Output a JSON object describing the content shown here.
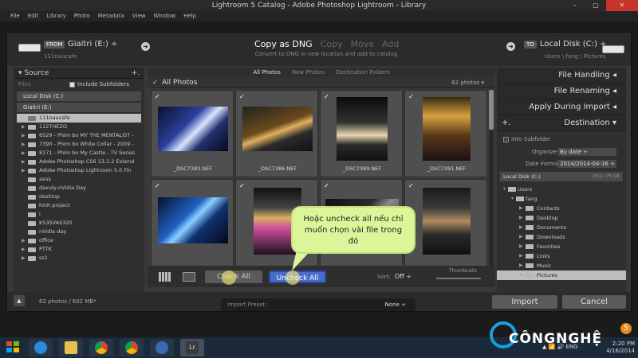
{
  "window": {
    "title": "Lightroom 5 Catalog - Adobe Photoshop Lightroom - Library",
    "min": "–",
    "max": "▢",
    "close": "✕"
  },
  "menu": [
    "File",
    "Edit",
    "Library",
    "Photo",
    "Metadata",
    "View",
    "Window",
    "Help"
  ],
  "header": {
    "from_tag": "FROM",
    "from_name": "Giaitri (E:) ÷",
    "from_path": "111naucafe",
    "modes": [
      "Copy as DNG",
      "Copy",
      "Move",
      "Add"
    ],
    "mode_desc": "Convert to DNG in new location and add to catalog",
    "to_tag": "TO",
    "to_name": "Local Disk (C:) ÷",
    "to_path": "Users \\ fang \\ Pictures"
  },
  "source": {
    "title": "Source",
    "plus": "+.",
    "files_label": "Files",
    "include_sub": "Include Subfolders",
    "drive1": "Local Disk (C:)",
    "drive2": "Giaitri (E:)",
    "folders": [
      "111naucafe",
      "112THEZO",
      "6529 - Phim bo MY THE MENTALIST -",
      "7390 - Phim bo White Collar - 2009 -",
      "8171 - Phim bo My Castle - TV Series",
      "Adobe Photoshop CS6 13.1.2 Extend",
      "Adobe Photoshop Lightroom 5.0 Fin",
      "asus",
      "daxuly-nVidia Day",
      "desktop",
      "hinh project",
      "i",
      "K53SVAS320",
      "nVidia day",
      "office",
      "PTTK",
      "ss1"
    ]
  },
  "center": {
    "tabs": [
      "All Photos",
      "New Photos",
      "Destination Folders"
    ],
    "all_label": "All Photos",
    "count": "62 photos ▾",
    "check_mark": "✓",
    "photos": [
      "_DSC7383.NEF",
      "_DSC7386.NEF",
      "_DSC7389.NEF",
      "_DSC7391.NEF",
      "",
      "",
      "",
      ""
    ]
  },
  "toolbar": {
    "check_all": "Check All",
    "uncheck_all": "Uncheck All",
    "sort_label": "Sort:",
    "sort_value": "Off ÷",
    "thumbs_label": "Thumbnails"
  },
  "right": {
    "sections": [
      "File Handling",
      "File Renaming",
      "Apply During Import"
    ],
    "dest_title": "Destination",
    "dest_plus": "+.",
    "into_sub": "Into Subfolder",
    "organize_l": "Organize",
    "organize_v": "By date ÷",
    "date_l": "Date Format",
    "date_v": "2014/2014-04-16 ÷",
    "drive": "Local Disk (C:)",
    "drive_size": "28.0 / 75 GB",
    "tree": [
      "Users",
      "fang",
      "Contacts",
      "Desktop",
      "Documents",
      "Downloads",
      "Favorites",
      "Links",
      "Music",
      "Pictures"
    ]
  },
  "footer": {
    "up": "▲",
    "info": "62 photos / 602 MB*",
    "preset_l": "Import Preset :",
    "preset_v": "None ÷",
    "import": "Import",
    "cancel": "Cancel"
  },
  "callout": "Hoặc uncheck all nếu chỉ muốn chọn vài file trong đó",
  "taskbar": {
    "tray": "▲ 📶 🔊 ENG",
    "time": "2:20 PM",
    "date": "4/16/2014"
  },
  "logo": {
    "text": "CÔNGNGHỆ",
    "badge": "5"
  },
  "colors": {
    "accent": "#4a6cc9",
    "callout": "#dcf598",
    "logo": "#1aa0e0"
  }
}
